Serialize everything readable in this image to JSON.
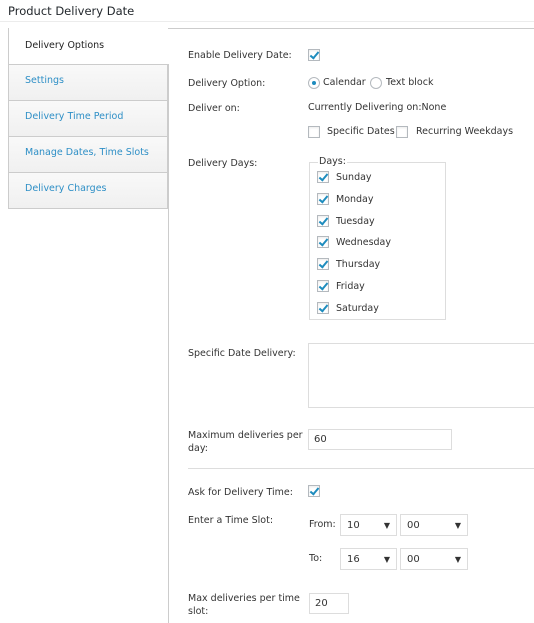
{
  "header": {
    "title": "Product Delivery Date"
  },
  "tabs": [
    {
      "label": "Delivery Options",
      "active": true
    },
    {
      "label": "Settings",
      "active": false
    },
    {
      "label": "Delivery Time Period",
      "active": false
    },
    {
      "label": "Manage Dates, Time Slots",
      "active": false
    },
    {
      "label": "Delivery Charges",
      "active": false
    }
  ],
  "form": {
    "enable_delivery_date": {
      "label": "Enable Delivery Date:",
      "checked": true
    },
    "delivery_option": {
      "label": "Delivery Option:",
      "options": [
        {
          "label": "Calendar",
          "selected": true
        },
        {
          "label": "Text block",
          "selected": false
        }
      ]
    },
    "deliver_on": {
      "label": "Deliver on:",
      "status": "Currently Delivering on:None",
      "specific_dates": {
        "label": "Specific Dates",
        "checked": false
      },
      "recurring_weekdays": {
        "label": "Recurring Weekdays",
        "checked": false
      }
    },
    "delivery_days": {
      "label": "Delivery Days:",
      "legend": "Days:",
      "days": [
        {
          "label": "Sunday",
          "checked": true
        },
        {
          "label": "Monday",
          "checked": true
        },
        {
          "label": "Tuesday",
          "checked": true
        },
        {
          "label": "Wednesday",
          "checked": true
        },
        {
          "label": "Thursday",
          "checked": true
        },
        {
          "label": "Friday",
          "checked": true
        },
        {
          "label": "Saturday",
          "checked": true
        }
      ]
    },
    "specific_date_delivery": {
      "label": "Specific Date Delivery:",
      "value": ""
    },
    "max_deliveries_per_day": {
      "label_line1": "Maximum deliveries per",
      "label_line2": "day:",
      "value": "60"
    },
    "ask_delivery_time": {
      "label": "Ask for Delivery Time:",
      "checked": true
    },
    "time_slot": {
      "label": "Enter a Time Slot:",
      "from_label": "From:",
      "to_label": "To:",
      "from_hour": "10",
      "from_minute": "00",
      "to_hour": "16",
      "to_minute": "00"
    },
    "max_deliveries_per_slot": {
      "label_line1": "Max deliveries per time",
      "label_line2": "slot:",
      "value": "20"
    }
  }
}
